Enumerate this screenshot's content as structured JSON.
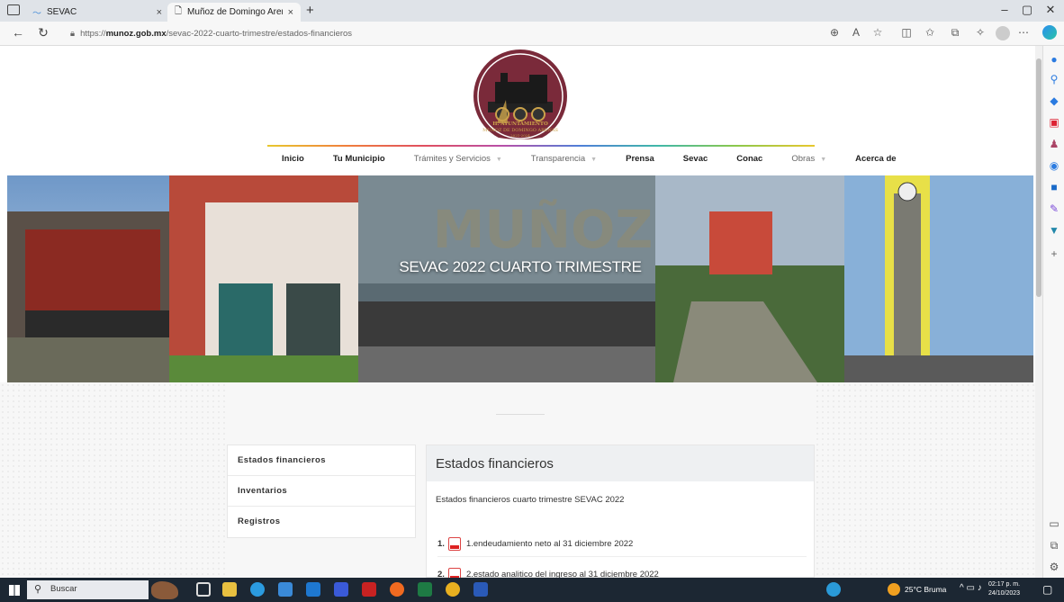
{
  "browser": {
    "tabs": [
      {
        "title": "SEVAC",
        "close": "×"
      },
      {
        "title": "Muñoz de Domingo Arenas",
        "close": "×"
      }
    ],
    "new_tab": "+",
    "window_controls": {
      "minimize": "–",
      "restore": "▢",
      "close": "✕"
    },
    "url_prefix": "https://",
    "url_domain": "munoz.gob.mx",
    "url_path": "/sevac-2022-cuarto-trimestre/estados-financieros"
  },
  "site": {
    "logo_text_1": "H. AYUNTAMIENTO",
    "logo_text_2": "MUÑOZ DE DOMINGO ARENAS",
    "logo_text_3": "2021-2024",
    "menu": [
      {
        "label": "Inicio"
      },
      {
        "label": "Tu Municipio"
      },
      {
        "label": "Trámites y Servicios"
      },
      {
        "label": "Transparencia"
      },
      {
        "label": "Prensa"
      },
      {
        "label": "Sevac"
      },
      {
        "label": "Conac"
      },
      {
        "label": "Obras"
      },
      {
        "label": "Acerca de"
      }
    ],
    "banner_word": "MUÑOZ",
    "banner_title": "SEVAC 2022 CUARTO TRIMESTRE",
    "sidebar_menu": [
      "Estados financieros",
      "Inventarios",
      "Registros"
    ],
    "content_title": "Estados financieros",
    "content_subtitle": "Estados financieros cuarto trimestre SEVAC 2022",
    "documents": [
      {
        "num": "1.",
        "label": "1.endeudamiento neto al 31 diciembre 2022"
      },
      {
        "num": "2.",
        "label": "2.estado analitico del ingreso al 31 diciembre 2022"
      }
    ]
  },
  "taskbar": {
    "search_label": "Buscar",
    "weather": "25°C  Bruma",
    "time": "02:17 p. m.",
    "date": "24/10/2023"
  },
  "colors": {
    "accent": "#7a2a3a",
    "taskbar": "#1c2733"
  }
}
